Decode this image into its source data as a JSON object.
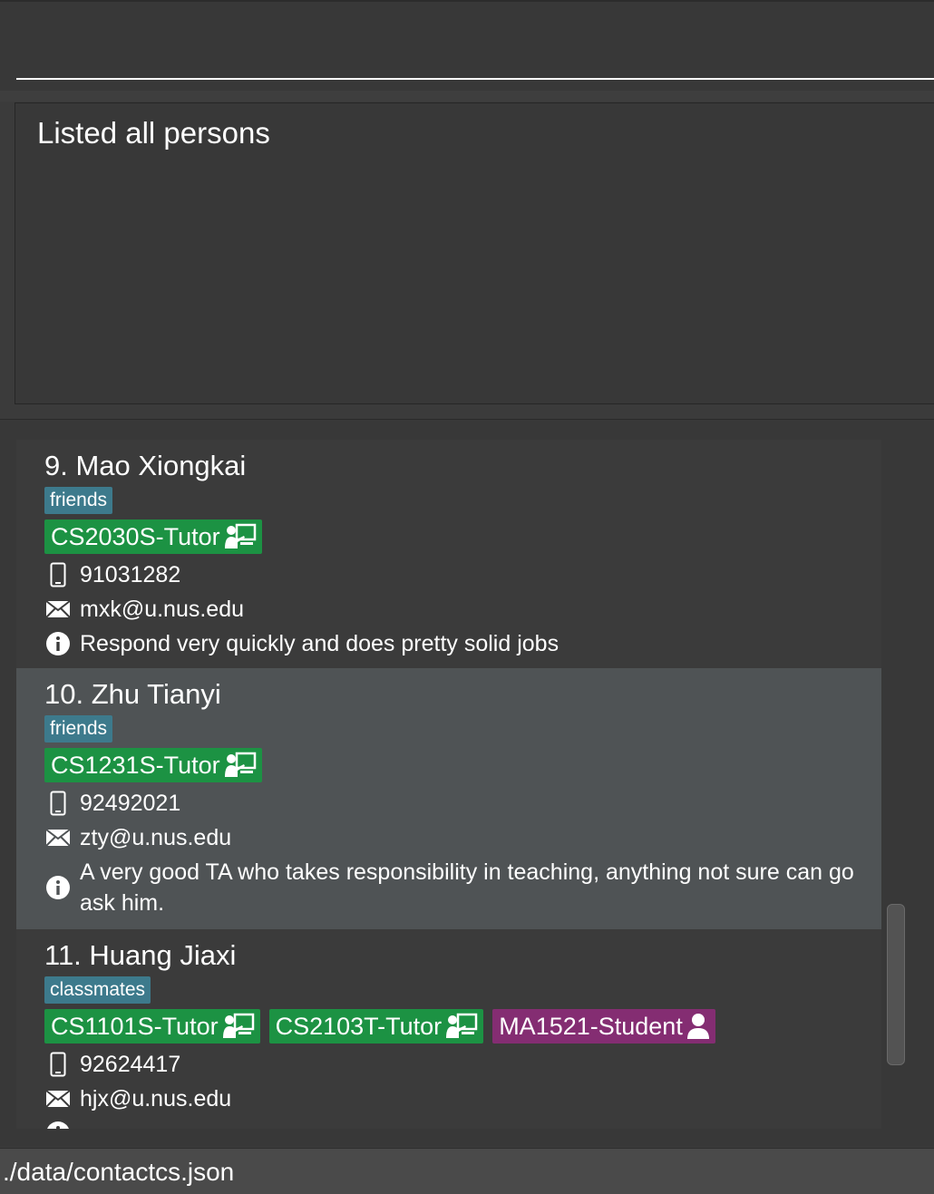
{
  "command_box": {
    "value": "",
    "placeholder": ""
  },
  "result_display": {
    "message": "Listed all persons"
  },
  "persons": [
    {
      "index_name": "9. Mao Xiongkai",
      "tags": [
        "friends"
      ],
      "roles": [
        {
          "label": "CS2030S-Tutor",
          "type": "tutor",
          "icon": "tutor-icon"
        }
      ],
      "phone": "91031282",
      "email": "mxk@u.nus.edu",
      "remark": "Respond very quickly and does pretty solid jobs"
    },
    {
      "index_name": "10. Zhu Tianyi",
      "tags": [
        "friends"
      ],
      "roles": [
        {
          "label": "CS1231S-Tutor",
          "type": "tutor",
          "icon": "tutor-icon"
        }
      ],
      "phone": "92492021",
      "email": "zty@u.nus.edu",
      "remark": "A very good TA who takes responsibility in teaching, anything not sure can go ask him."
    },
    {
      "index_name": "11. Huang Jiaxi",
      "tags": [
        "classmates"
      ],
      "roles": [
        {
          "label": "CS1101S-Tutor",
          "type": "tutor",
          "icon": "tutor-icon"
        },
        {
          "label": "CS2103T-Tutor",
          "type": "tutor",
          "icon": "tutor-icon"
        },
        {
          "label": "MA1521-Student",
          "type": "student",
          "icon": "student-icon"
        }
      ],
      "phone": "92624417",
      "email": "hjx@u.nus.edu",
      "remark": ""
    }
  ],
  "status_bar": {
    "file_path": "./data/contactcs.json"
  },
  "colors": {
    "tag_bg": "#3d7a8c",
    "tutor_bg": "#1c9243",
    "student_bg": "#842d72",
    "selected_card_bg": "#4f5355"
  }
}
